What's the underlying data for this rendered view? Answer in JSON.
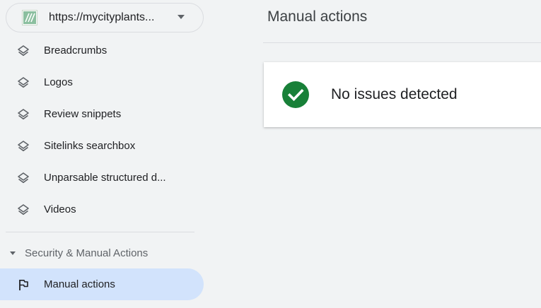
{
  "sidebar": {
    "property": {
      "url": "https://mycityplants..."
    },
    "items": [
      {
        "label": "Breadcrumbs",
        "icon": "layers-icon"
      },
      {
        "label": "Logos",
        "icon": "layers-icon"
      },
      {
        "label": "Review snippets",
        "icon": "layers-icon"
      },
      {
        "label": "Sitelinks searchbox",
        "icon": "layers-icon"
      },
      {
        "label": "Unparsable structured d...",
        "icon": "layers-icon"
      },
      {
        "label": "Videos",
        "icon": "layers-icon"
      }
    ],
    "section": {
      "label": "Security & Manual Actions",
      "expanded": true,
      "items": [
        {
          "label": "Manual actions",
          "icon": "flag-icon",
          "active": true
        }
      ]
    }
  },
  "main": {
    "title": "Manual actions",
    "status": {
      "message": "No issues detected",
      "icon": "check-circle-icon"
    }
  },
  "colors": {
    "active_bg": "#d2e3fc",
    "success_green": "#188038",
    "page_bg": "#f1f3f4",
    "card_bg": "#ffffff"
  }
}
